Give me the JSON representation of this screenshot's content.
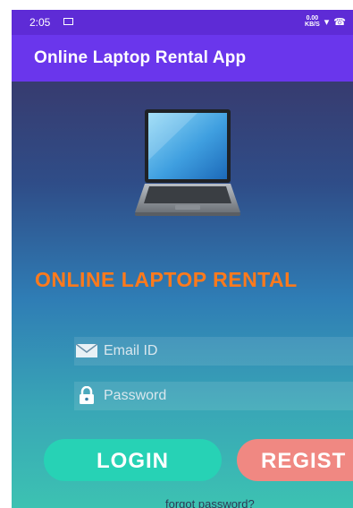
{
  "status_bar": {
    "time": "2:05",
    "net_speed_value": "0.00",
    "net_speed_unit": "KB/S",
    "icons": [
      "mail-icon",
      "wifi-icon",
      "call-icon"
    ]
  },
  "app_bar": {
    "title": "Online Laptop Rental App"
  },
  "hero": {
    "image": "laptop-image"
  },
  "heading": "ONLINE LAPTOP RENTAL",
  "form": {
    "email": {
      "placeholder": "Email ID",
      "value": "",
      "icon": "envelope-icon"
    },
    "password": {
      "placeholder": "Password",
      "value": "",
      "icon": "lock-icon"
    }
  },
  "buttons": {
    "login": "LOGIN",
    "register": "REGIST"
  },
  "forgot_password": "forgot password?",
  "colors": {
    "status_bar": "#5e2bd6",
    "app_bar": "#6a36ec",
    "heading": "#ff7a1c",
    "login_button": "#27d2b5",
    "register_button": "#f08882"
  }
}
